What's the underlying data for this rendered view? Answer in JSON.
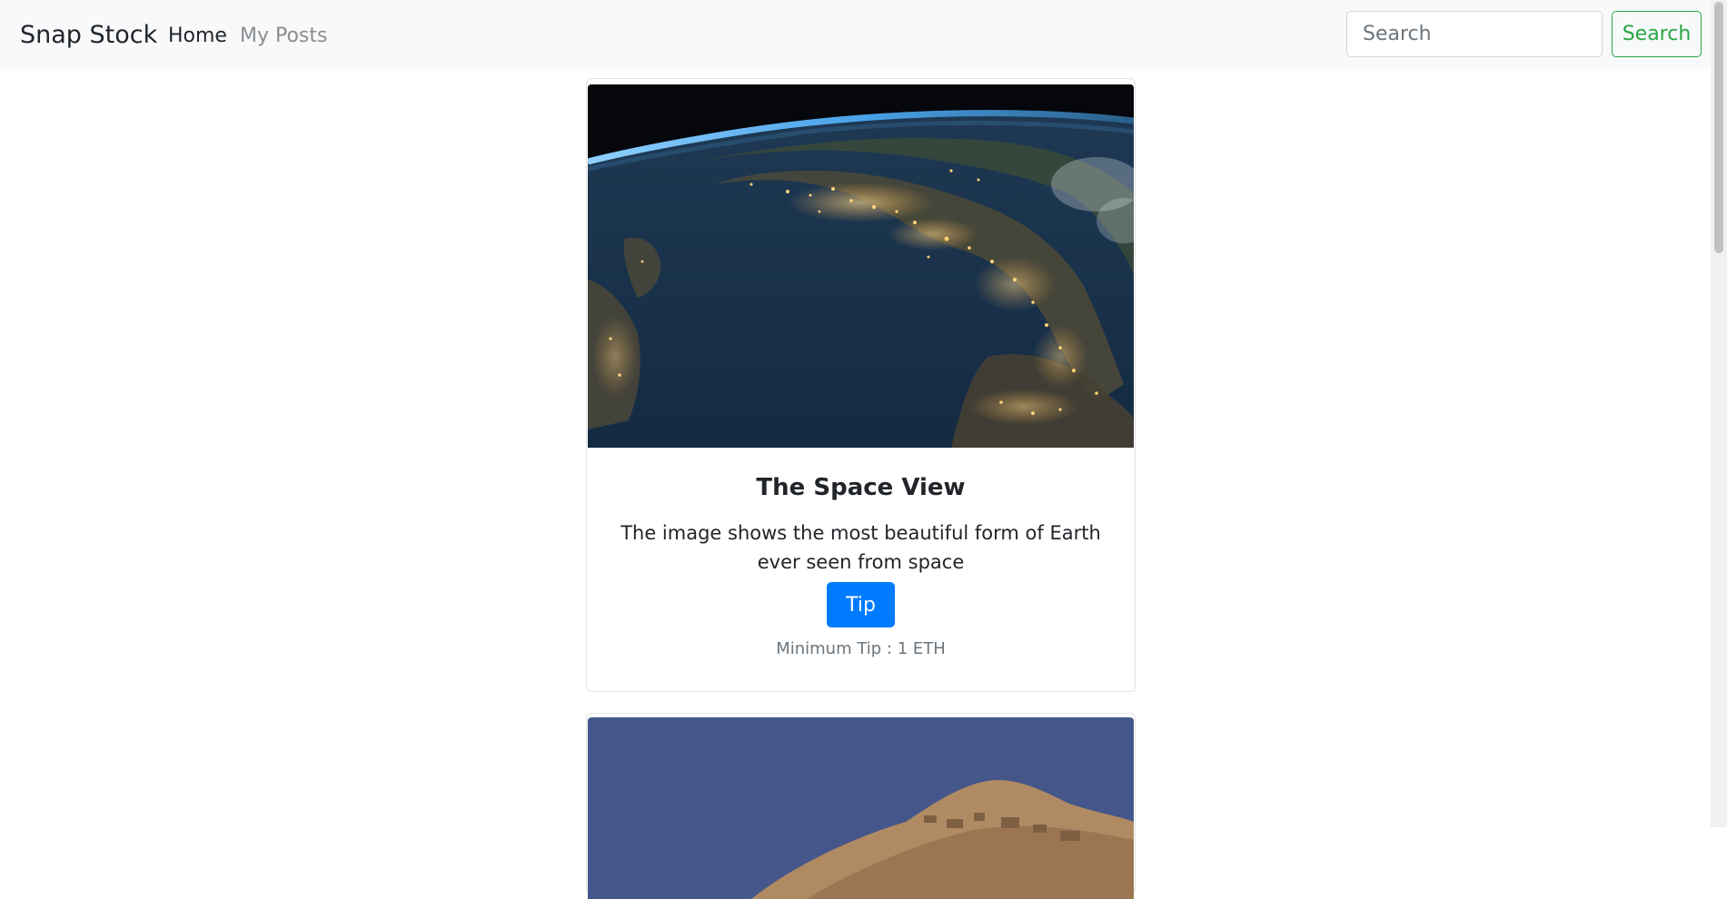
{
  "navbar": {
    "brand": "Snap Stock",
    "links": [
      {
        "label": "Home"
      },
      {
        "label": "My Posts"
      }
    ],
    "search": {
      "placeholder": "Search",
      "value": "",
      "button_label": "Search"
    }
  },
  "posts": [
    {
      "title": "The Space View",
      "description": "The image shows the most beautiful form of Earth ever seen from space",
      "tip_label": "Tip",
      "min_tip": "Minimum Tip : 1 ETH"
    }
  ],
  "colors": {
    "primary": "#007bff",
    "success": "#28a745",
    "navbar_bg": "#f8f9fa",
    "muted": "#6c757d"
  }
}
